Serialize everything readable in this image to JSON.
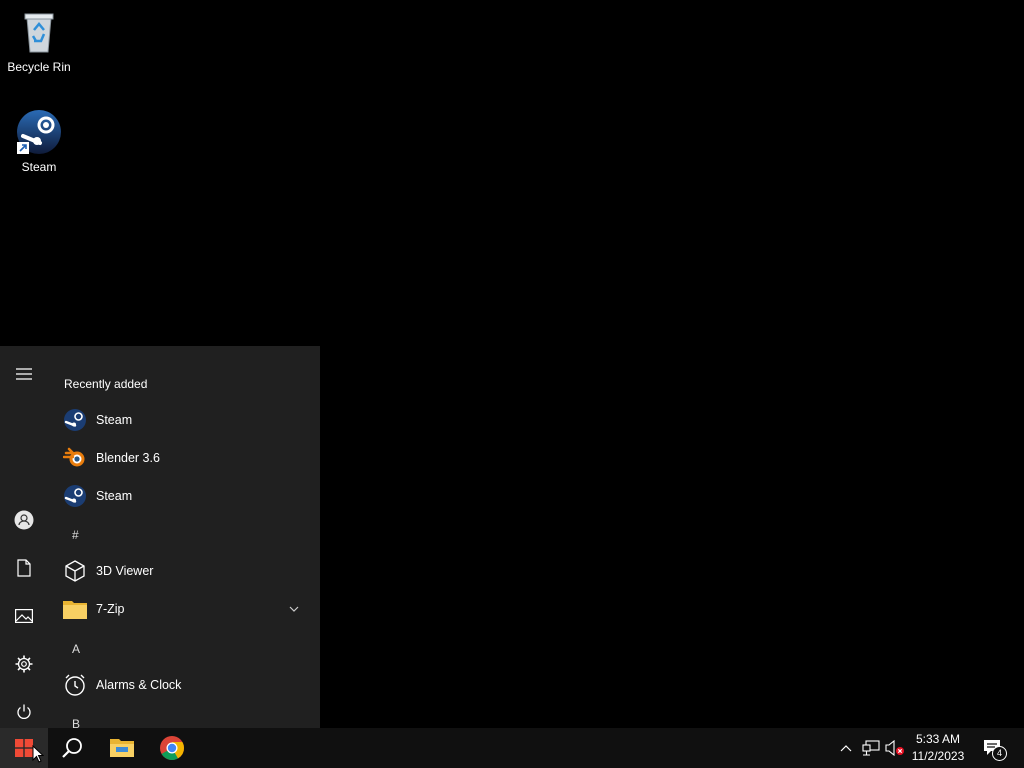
{
  "desktop": {
    "icons": [
      {
        "label": "Becycle Rin",
        "icon": "recycle-bin-icon"
      },
      {
        "label": "Steam",
        "icon": "steam-icon"
      }
    ]
  },
  "start_menu": {
    "recently_added_title": "Recently added",
    "recent": [
      {
        "label": "Steam",
        "icon": "steam-icon"
      },
      {
        "label": "Blender 3.6",
        "icon": "blender-icon"
      },
      {
        "label": "Steam",
        "icon": "steam-icon"
      }
    ],
    "letter_hash": "#",
    "apps_hash": [
      {
        "label": "3D Viewer",
        "icon": "cube-icon"
      },
      {
        "label": "7-Zip",
        "icon": "folder-icon"
      }
    ],
    "letter_a": "A",
    "apps_a": [
      {
        "label": "Alarms & Clock",
        "icon": "alarm-clock-icon"
      }
    ],
    "letter_b": "B",
    "rail": [
      "hamburger-menu-icon",
      "user-icon",
      "documents-icon",
      "pictures-icon",
      "settings-icon",
      "power-icon"
    ]
  },
  "taskbar": {
    "pinned": [
      "windows-start-icon",
      "search-icon",
      "file-explorer-icon",
      "chrome-icon"
    ],
    "tray": {
      "time": "5:33 AM",
      "date": "11/2/2023",
      "notification_count": "4"
    }
  }
}
